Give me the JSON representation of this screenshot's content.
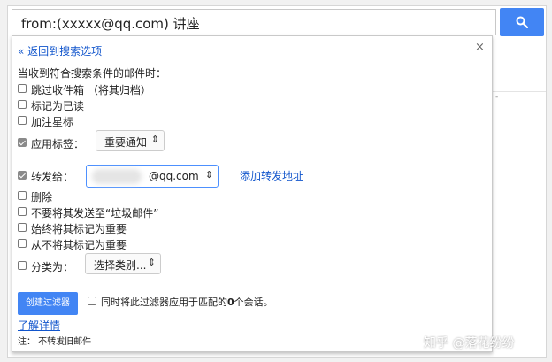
{
  "search": {
    "query": "from:(xxxxx@qq.com) 讲座",
    "button_icon": "search-icon"
  },
  "panel": {
    "back_link": "« 返回到搜索选项",
    "close": "×",
    "heading": "当收到符合搜索条件的邮件时：",
    "options": {
      "skip_inbox": {
        "label": "跳过收件箱 （将其归档）",
        "checked": false
      },
      "mark_read": {
        "label": "标记为已读",
        "checked": false
      },
      "star": {
        "label": "加注星标",
        "checked": false
      },
      "apply_label": {
        "label": "应用标签：",
        "checked": true,
        "select_value": "重要通知"
      },
      "forward": {
        "label": "转发给：",
        "checked": true,
        "domain": "@qq.com",
        "add_link": "添加转发地址"
      },
      "delete": {
        "label": "删除",
        "checked": false
      },
      "never_spam": {
        "label": "不要将其发送至“垃圾邮件”",
        "checked": false
      },
      "always_important": {
        "label": "始终将其标记为重要",
        "checked": false
      },
      "never_important": {
        "label": "从不将其标记为重要",
        "checked": false
      },
      "categorize": {
        "label": "分类为：",
        "checked": false,
        "select_value": "选择类别..."
      }
    },
    "create_button": "创建过滤器",
    "apply_existing": {
      "prefix": "同时将此过滤器应用于匹配的",
      "count": "0",
      "suffix": "个会话。",
      "checked": false
    },
    "learn_more": "了解详情",
    "note": "注：  不转发旧邮件"
  },
  "watermark": "知乎 @落花纷纷",
  "colors": {
    "accent": "#4285f4",
    "link": "#1155cc"
  }
}
